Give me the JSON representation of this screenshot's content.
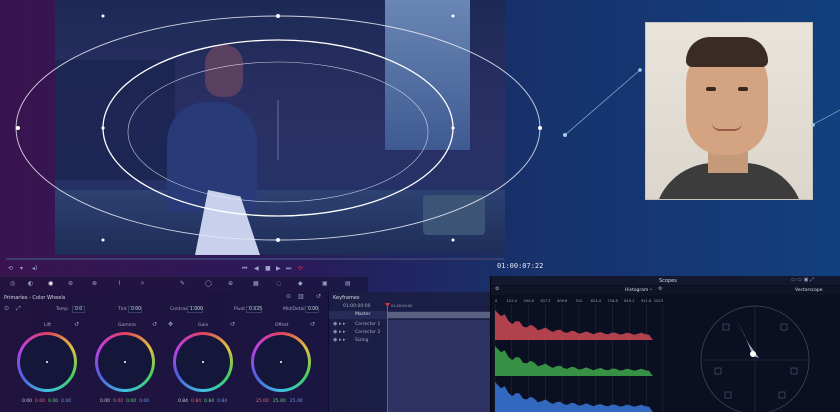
{
  "viewer": {
    "timecode": "01:00:07:22"
  },
  "primaries": {
    "title": "Primaries - Color Wheels",
    "fields": {
      "temp_label": "Temp",
      "temp_value": "0.0",
      "tint_label": "Tint",
      "tint_value": "0.00",
      "contrast_label": "Contrast",
      "contrast_value": "1.000",
      "pivot_label": "Pivot",
      "pivot_value": "0.435",
      "middetail_label": "Mid/Detail",
      "middetail_value": "0.00"
    },
    "wheels": [
      {
        "label": "Lift",
        "values": [
          "0.00",
          "0.00",
          "0.00",
          "0.00"
        ]
      },
      {
        "label": "Gamma",
        "values": [
          "0.00",
          "0.00",
          "0.00",
          "0.00"
        ]
      },
      {
        "label": "Gain",
        "values": [
          "0.84",
          "0.84",
          "0.84",
          "0.84"
        ]
      },
      {
        "label": "Offset",
        "values": [
          "25.00",
          "25.00",
          "25.00"
        ]
      }
    ]
  },
  "keyframes": {
    "title": "Keyframes",
    "time_left": "01:00:00:00",
    "time_right": "01:00:00:00",
    "master": "Master",
    "tracks": [
      "Corrector 1",
      "Corrector 2",
      "Sizing"
    ]
  },
  "scopes": {
    "title": "Scopes",
    "mode": "Histogram",
    "vector_label": "Vectorscope",
    "axis_ticks": [
      "0",
      "102.4",
      "204.8",
      "307.2",
      "409.6",
      "512",
      "614.4",
      "716.8",
      "819.2",
      "921.6",
      "1023"
    ]
  },
  "colors": {
    "accent_red": "#e2323c",
    "histogram_red": "#d04a56",
    "histogram_green": "#3fa84a",
    "histogram_blue": "#3a78d8"
  }
}
